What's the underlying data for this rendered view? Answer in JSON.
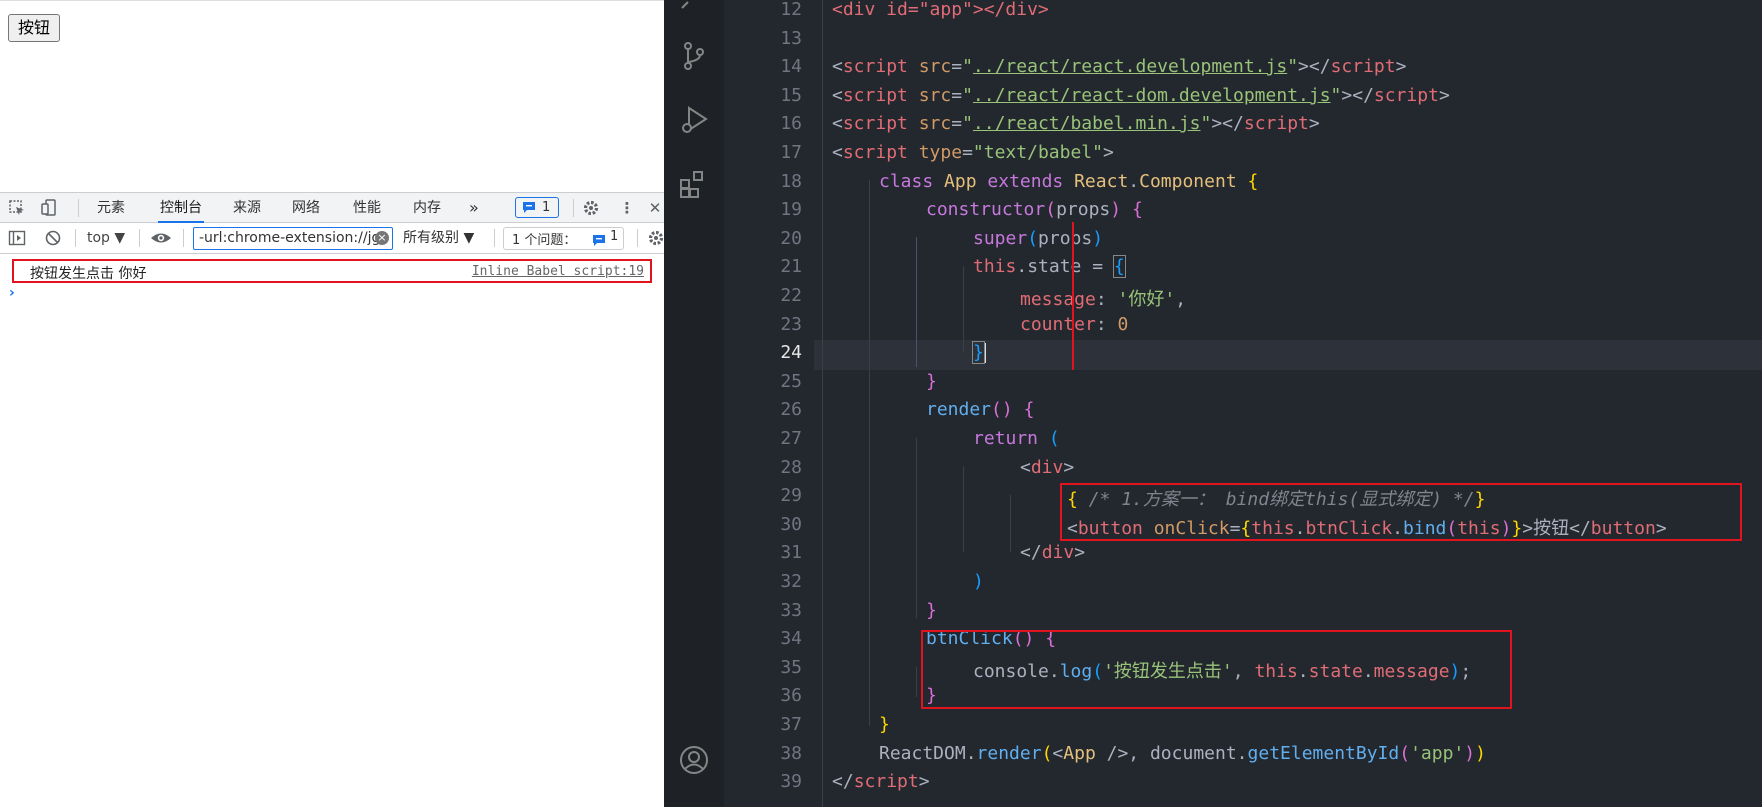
{
  "browser": {
    "page_button_label": "按钮",
    "devtools": {
      "tabs": [
        "元素",
        "控制台",
        "来源",
        "网络",
        "性能",
        "内存"
      ],
      "more_tabs": "»",
      "issue_badge_count": "1",
      "context_label": "top ▼",
      "filter_value": "-url:chrome-extension://jg",
      "level_label": "所有级别 ▼",
      "issues_label": "1 个问题：",
      "issues_count": "1",
      "console_message": "按钮发生点击  你好",
      "console_source": "Inline Babel script:19",
      "prompt": "›"
    }
  },
  "editor": {
    "current_line": "24",
    "line_numbers": [
      "12",
      "13",
      "14",
      "15",
      "16",
      "17",
      "18",
      "19",
      "20",
      "21",
      "22",
      "23",
      "24",
      "25",
      "26",
      "27",
      "28",
      "29",
      "30",
      "31",
      "32",
      "33",
      "34",
      "35",
      "36",
      "37",
      "38",
      "39"
    ],
    "tokens": {
      "div_id_app": "<div id=\"app\"></div>",
      "l14_src": "../react/react.development.js",
      "l15_src": "../react/react-dom.development.js",
      "l16_src": "../react/babel.min.js",
      "l17_type": "\"text/babel\"",
      "l18_class": "class",
      "l18_name": "App",
      "l18_extends": "extends",
      "l18_react": "React",
      "l18_component": "Component",
      "l19_ctor": "constructor",
      "l19_props": "props",
      "l20_super": "super",
      "l21_this": "this",
      "l21_state": ".state = ",
      "l22_key": "message",
      "l22_val": "'你好'",
      "l23_key": "counter",
      "l23_val": "0",
      "l26_render": "render",
      "l27_return": "return",
      "l28_div": "div",
      "l29_comment": "/* 1.方案一： bind绑定this(显式绑定) */",
      "l30_button": "button",
      "l30_onclick": "onClick",
      "l30_this": "this",
      "l30_btnclick": "btnClick",
      "l30_bind": "bind",
      "l30_label": "按钮",
      "l34_name": "btnClick",
      "l35_console": "console",
      "l35_log": "log",
      "l35_str": "'按钮发生点击'",
      "l35_this": "this",
      "l35_state": "state",
      "l35_message": "message",
      "l38_reactdom": "ReactDOM",
      "l38_render": "render",
      "l38_app": "App",
      "l38_document": "document",
      "l38_getel": "getElementById",
      "l38_arg": "'app'",
      "script": "script",
      "src": "src",
      "type": "type"
    }
  },
  "colors": {
    "highlight_box": "#e0131f",
    "editor_bg": "#23272e",
    "devtools_accent": "#1a73e8"
  }
}
